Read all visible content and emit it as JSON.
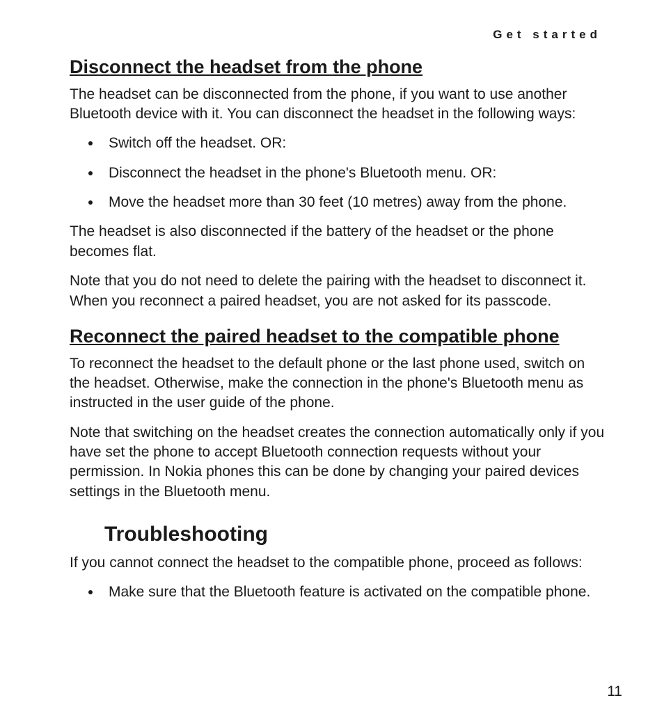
{
  "running_head": "Get started",
  "sections": {
    "disconnect": {
      "title": "Disconnect the headset from the phone",
      "para1": "The headset can be disconnected from the phone, if you want to use another Bluetooth device with it. You can disconnect the headset in the following ways:",
      "bullets": [
        "Switch off the headset. OR:",
        "Disconnect the headset in the phone's Bluetooth menu. OR:",
        "Move the headset more than 30 feet (10 metres) away from the phone."
      ],
      "para2": "The headset is also disconnected if the battery of the headset or the phone becomes flat.",
      "para3": "Note that you do not need to delete the pairing with the headset to disconnect it. When you reconnect a paired headset, you are not asked for its passcode."
    },
    "reconnect": {
      "title": "Reconnect the paired headset to the compatible phone",
      "para1": "To reconnect the headset to the default phone or the last phone used, switch on the headset. Otherwise, make the connection in the phone's Bluetooth menu as instructed in the user guide of the phone.",
      "para2": "Note that switching on the headset creates the connection automatically only if you have set the phone to accept Bluetooth connection requests without your permission. In Nokia phones this can be done by changing your paired devices settings in the Bluetooth menu."
    },
    "troubleshooting": {
      "title": "Troubleshooting",
      "para1": "If you cannot connect the headset to the compatible phone, proceed as follows:",
      "bullets": [
        "Make sure that the Bluetooth feature is activated on the compatible phone."
      ]
    }
  },
  "page_number": "11"
}
